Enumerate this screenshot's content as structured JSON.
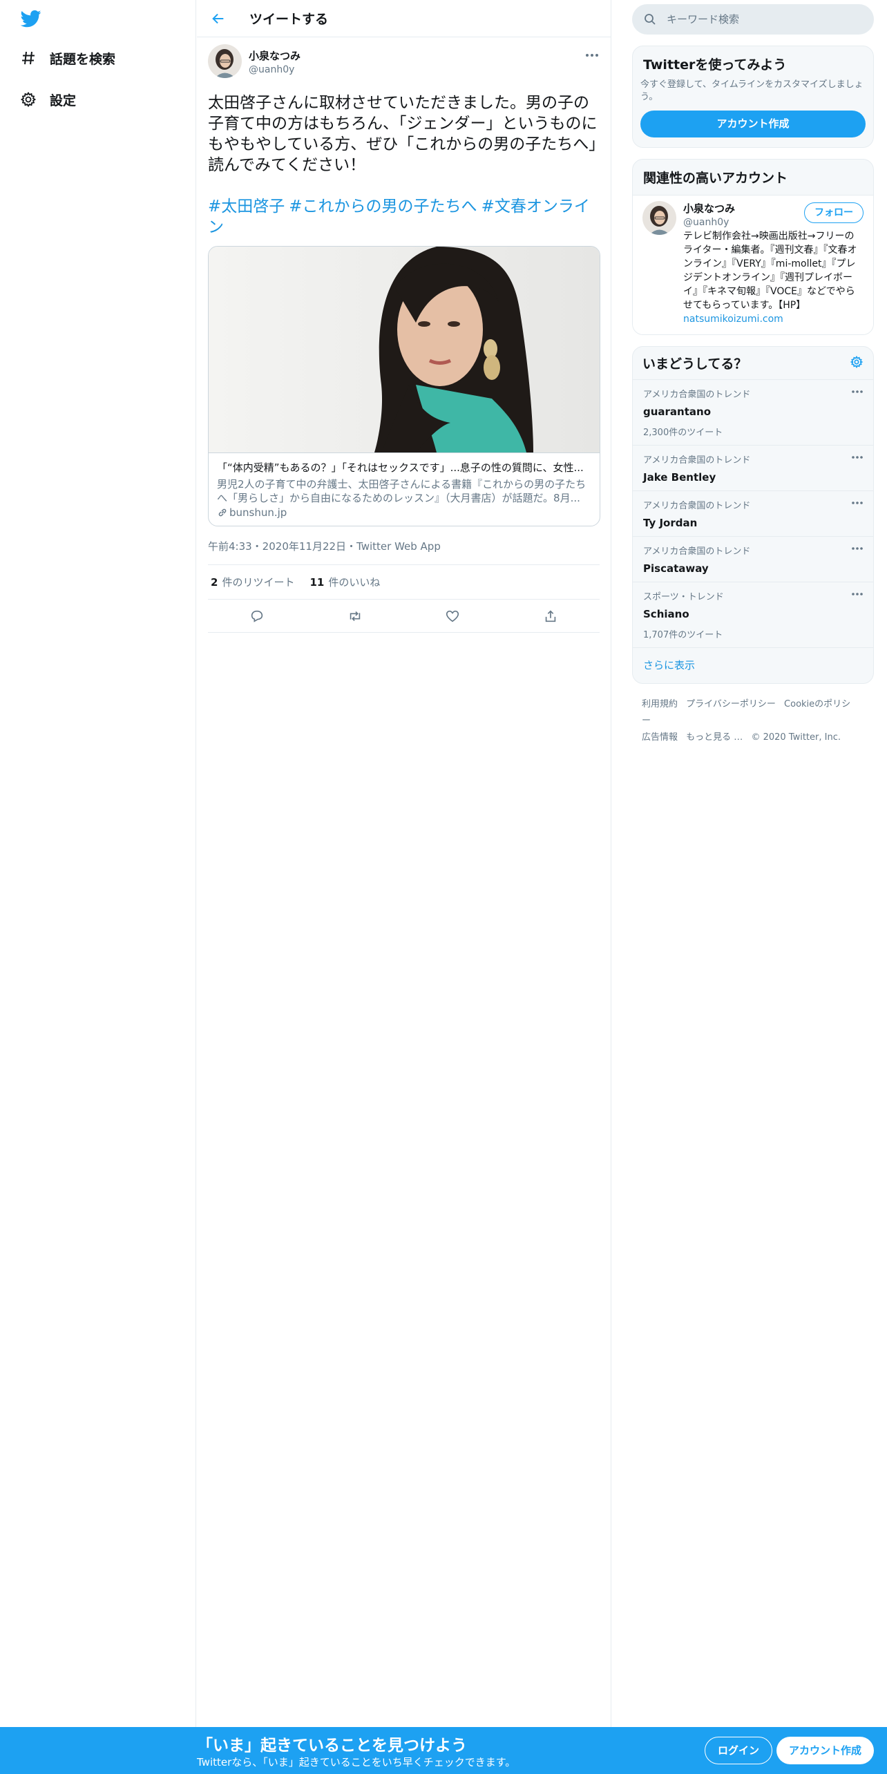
{
  "nav": {
    "items": [
      {
        "label": "話題を検索",
        "icon": "hashtag-icon"
      },
      {
        "label": "設定",
        "icon": "gear-icon"
      }
    ]
  },
  "header": {
    "title": "ツイートする"
  },
  "tweet": {
    "author_name": "小泉なつみ",
    "author_handle": "@uanh0y",
    "text": "太田啓子さんに取材させていただきました。男の子の子育て中の方はもちろん、「ジェンダー」というものにもやもやしている方、ぜひ「これからの男の子たちへ」読んでみてください！",
    "hashtags": [
      "#太田啓子",
      "#これからの男の子たちへ",
      "#文春オンライン"
    ],
    "card": {
      "title": "「“体内受精”もあるの？」「それはセックスです」...息子の性の質問に、女性...",
      "description": "男児2人の子育て中の弁護士、太田啓子さんによる書籍『これからの男の子たちへ「男らしさ」から自由になるためのレッスン』（大月書店）が話題だ。8月...",
      "domain": "bunshun.jp"
    },
    "meta": "午前4:33・2020年11月22日・Twitter Web App",
    "retweets": "2",
    "retweets_label": "件のリツイート",
    "likes": "11",
    "likes_label": "件のいいね"
  },
  "search": {
    "placeholder": "キーワード検索"
  },
  "signup_panel": {
    "title": "Twitterを使ってみよう",
    "desc": "今すぐ登録して、タイムラインをカスタマイズしましょう。",
    "button": "アカウント作成"
  },
  "related": {
    "title": "関連性の高いアカウント",
    "name": "小泉なつみ",
    "handle": "@uanh0y",
    "bio": "テレビ制作会社→映画出版社→フリーのライター・編集者。『週刊文春』『文春オンライン』『VERY』『mi-mollet』『プレジデントオンライン』『週刊プレイボーイ』『キネマ旬報』『VOCE』などでやらせてもらっています。【HP】",
    "bio_link": "natsumikoizumi.com",
    "follow": "フォロー"
  },
  "trends": {
    "title": "いまどうしてる？",
    "items": [
      {
        "context": "アメリカ合衆国のトレンド",
        "name": "guarantano",
        "count": "2,300件のツイート"
      },
      {
        "context": "アメリカ合衆国のトレンド",
        "name": "Jake Bentley",
        "count": ""
      },
      {
        "context": "アメリカ合衆国のトレンド",
        "name": "Ty Jordan",
        "count": ""
      },
      {
        "context": "アメリカ合衆国のトレンド",
        "name": "Piscataway",
        "count": ""
      },
      {
        "context": "スポーツ・トレンド",
        "name": "Schiano",
        "count": "1,707件のツイート"
      }
    ],
    "show_more": "さらに表示"
  },
  "footer": {
    "links": [
      "利用規約",
      "プライバシーポリシー",
      "Cookieのポリシー",
      "広告情報",
      "もっと見る …",
      "© 2020 Twitter, Inc."
    ]
  },
  "bottom_bar": {
    "title": "「いま」起きていることを見つけよう",
    "subtitle": "Twitterなら、「いま」起きていることをいち早くチェックできます。",
    "login": "ログイン",
    "signup": "アカウント作成"
  },
  "colors": {
    "accent": "#1da1f2",
    "link": "#1b95e0",
    "border": "#e6ecf0",
    "muted": "#657786"
  }
}
